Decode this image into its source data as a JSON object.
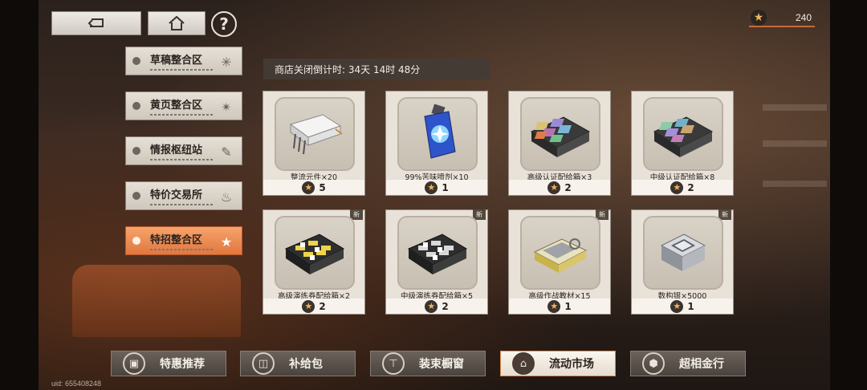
{
  "currency": {
    "amount": "240",
    "icon": "star-token-icon"
  },
  "sidebar": {
    "tabs": [
      {
        "label": "草稿整合区",
        "icon": "sparkle-icon"
      },
      {
        "label": "黄页整合区",
        "icon": "compass-star-icon"
      },
      {
        "label": "情报枢纽站",
        "icon": "edit-icon"
      },
      {
        "label": "特价交易所",
        "icon": "pot-icon"
      },
      {
        "label": "特招整合区",
        "icon": "star-icon"
      }
    ],
    "active_index": 4
  },
  "countdown": {
    "text": "商店关闭倒计时: 34天 14时 48分"
  },
  "items": [
    {
      "name": "整流元件×20",
      "price": "5",
      "is_new": false,
      "rarity": "gold"
    },
    {
      "name": "99%苦味喷剂×10",
      "price": "1",
      "is_new": false,
      "rarity": "gold"
    },
    {
      "name": "高级认证配给箱×3",
      "price": "2",
      "is_new": false,
      "rarity": "gold"
    },
    {
      "name": "中级认证配给箱×8",
      "price": "2",
      "is_new": false,
      "rarity": "purple"
    },
    {
      "name": "高级演练券配给箱×2",
      "price": "2",
      "is_new": true,
      "rarity": "gold"
    },
    {
      "name": "中级演练券配给箱×5",
      "price": "2",
      "is_new": true,
      "rarity": "purple"
    },
    {
      "name": "高级作战教材×15",
      "price": "1",
      "is_new": true,
      "rarity": "gold"
    },
    {
      "name": "数构银×5000",
      "price": "1",
      "is_new": true,
      "rarity": "purple"
    }
  ],
  "new_label": "新",
  "bottom_nav": [
    {
      "label": "特惠推荐",
      "icon": "gift-box-icon"
    },
    {
      "label": "补给包",
      "icon": "bag-icon"
    },
    {
      "label": "装束橱窗",
      "icon": "shirt-icon"
    },
    {
      "label": "流动市场",
      "icon": "market-stall-icon"
    },
    {
      "label": "超相金行",
      "icon": "cube-icon"
    }
  ],
  "bottom_nav_active": 3,
  "uid": "uid: 655408248",
  "colors": {
    "accent": "#e0773f",
    "gold": "#e3a826",
    "purple": "#9b55d4"
  }
}
